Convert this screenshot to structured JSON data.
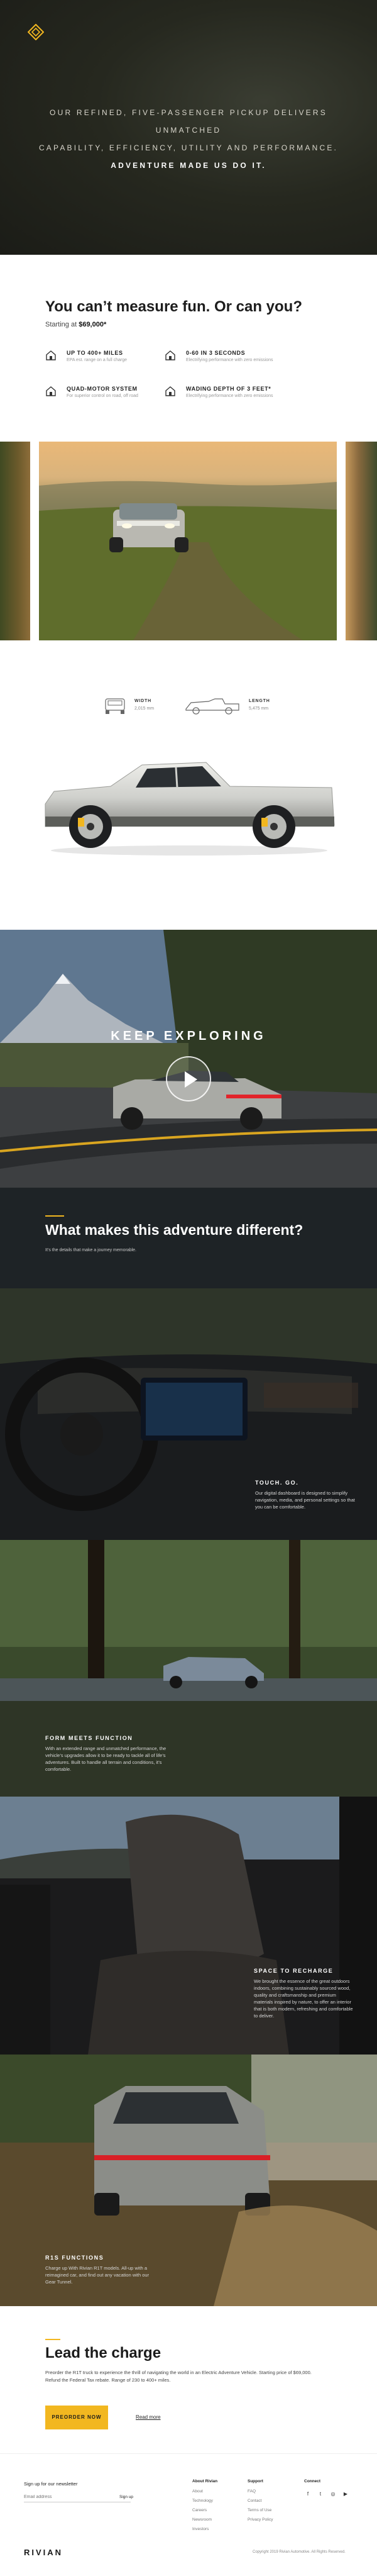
{
  "hero": {
    "line1": "OUR REFINED, FIVE-PASSENGER PICKUP DELIVERS UNMATCHED",
    "line2": "CAPABILITY, EFFICIENCY, UTILITY AND PERFORMANCE.",
    "line3": "ADVENTURE MADE US DO IT."
  },
  "specs": {
    "title": "You can’t measure fun. Or can you?",
    "price_prefix": "Starting at",
    "price_value": "$69,000*",
    "items": [
      {
        "title": "UP TO 400+ MILES",
        "sub": "EPA est. range on a full charge"
      },
      {
        "title": "0-60 IN 3 SECONDS",
        "sub": "Electrifying performance with zero emissions"
      },
      {
        "title": "QUAD-MOTOR SYSTEM",
        "sub": "For superior control on road, off road"
      },
      {
        "title": "WADING DEPTH OF 3 FEET*",
        "sub": "Electrifying performance with zero emissions"
      }
    ]
  },
  "dimensions": {
    "width_label": "WIDTH",
    "width_value": "2,015 mm",
    "length_label": "LENGTH",
    "length_value": "5,475 mm"
  },
  "explore": {
    "title": "KEEP EXPLORING"
  },
  "different": {
    "title": "What makes this adventure different?",
    "subtitle": "It’s the details that make a journey memorable."
  },
  "features": [
    {
      "title": "TOUCH. GO.",
      "text": "Our digital dashboard is designed to simplify navigation, media, and personal settings so that you can be comfortable."
    },
    {
      "title": "FORM MEETS FUNCTION",
      "text": "With an extended range and unmatched performance, the vehicle’s upgrades allow it to be ready to tackle all of life’s adventures. Built to handle all terrain and conditions, it’s comfortable."
    },
    {
      "title": "SPACE TO RECHARGE",
      "text": "We brought the essence of the great outdoors indoors, combining sustainably sourced wood, quality and craftsmanship and premium materials inspired by nature, to offer an interior that is both modern, refreshing and comfortable to deliver."
    },
    {
      "title": "R1S FUNCTIONS",
      "text": "Charge up With Rivian R1T models. All-up with a reimagined car, and find out any vacation with our Gear Tunnel."
    }
  ],
  "lead": {
    "title": "Lead the charge",
    "text": "Preorder the R1T truck to experience the thrill of navigating the world in an Electric Adventure Vehicle. Starting price of $69,000. Refund the Federal Tax rebate. Range of 230 to 400+ miles.",
    "button": "PREORDER NOW",
    "link": "Read more"
  },
  "footer": {
    "newsletter_label": "Sign up for our newsletter",
    "email_placeholder": "Email address",
    "signup": "Sign up",
    "columns": [
      {
        "heading": "About Rivian",
        "items": [
          "About",
          "Technology",
          "Careers",
          "Newsroom",
          "Investors"
        ]
      },
      {
        "heading": "Support",
        "items": [
          "FAQ",
          "Contact",
          "Terms of Use",
          "Privacy Policy"
        ]
      },
      {
        "heading": "Connect",
        "items": []
      }
    ],
    "wordmark": "RIVIAN",
    "copyright": "Copyright 2019 Rivian Automotive. All Rights Reserved."
  },
  "colors": {
    "accent": "#f2b720",
    "dark": "#1e2326",
    "hero_bg": "#26281f"
  },
  "icons": [
    "rivian-logo-icon",
    "home-icon",
    "play-icon",
    "facebook-icon",
    "twitter-icon",
    "instagram-icon",
    "youtube-icon"
  ]
}
